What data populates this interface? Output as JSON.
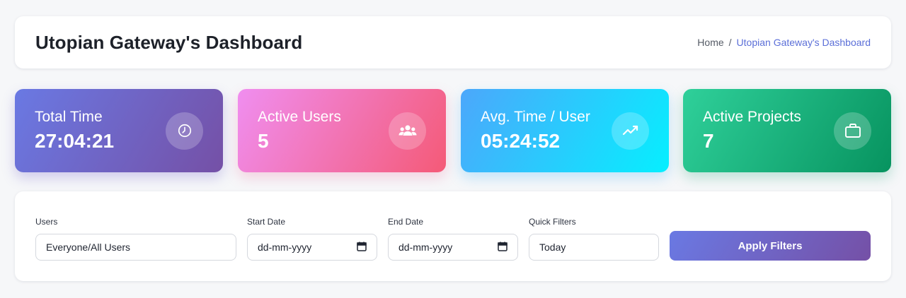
{
  "header": {
    "title": "Utopian Gateway's Dashboard",
    "breadcrumb": {
      "home": "Home",
      "separator": "/",
      "current": "Utopian Gateway's Dashboard"
    }
  },
  "stats": [
    {
      "label": "Total Time",
      "value": "27:04:21",
      "icon": "clock-icon"
    },
    {
      "label": "Active Users",
      "value": "5",
      "icon": "users-icon"
    },
    {
      "label": "Avg. Time / User",
      "value": "05:24:52",
      "icon": "trend-line-icon"
    },
    {
      "label": "Active Projects",
      "value": "7",
      "icon": "briefcase-icon"
    }
  ],
  "filters": {
    "users": {
      "label": "Users",
      "value": "Everyone/All Users"
    },
    "start_date": {
      "label": "Start Date",
      "placeholder": "dd-mm-yyyy"
    },
    "end_date": {
      "label": "End Date",
      "placeholder": "dd-mm-yyyy"
    },
    "quick": {
      "label": "Quick Filters",
      "value": "Today"
    },
    "apply_label": "Apply Filters"
  },
  "colors": {
    "accent": "#5b6fd8",
    "total_time_gradient": [
      "#6a79e3",
      "#7550a6"
    ],
    "active_users_gradient": [
      "#f08ef0",
      "#f45a77"
    ],
    "avg_time_gradient": [
      "#4ca7fb",
      "#06efff"
    ],
    "active_projects_gradient": [
      "#2fd09a",
      "#07935f"
    ]
  }
}
